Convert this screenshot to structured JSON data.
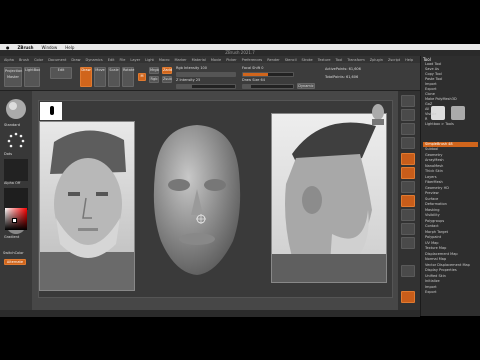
{
  "mac_menu": {
    "apple": "",
    "app": "ZBrush",
    "window": "Window",
    "help": "Help"
  },
  "window_title": "ZBrush 2021.7",
  "main_menu": [
    "Alpha",
    "Brush",
    "Color",
    "Document",
    "Draw",
    "Dynamics",
    "Edit",
    "File",
    "Layer",
    "Light",
    "Macro",
    "Marker",
    "Material",
    "Movie",
    "Picker",
    "Preferences",
    "Render",
    "Stencil",
    "Stroke",
    "Texture",
    "Tool",
    "Transform",
    "Zplugin",
    "Zscript",
    "Help"
  ],
  "top_shelf": {
    "projection": "Projection Master",
    "lightbox": "LightBox",
    "edit": "Edit",
    "draw": "Draw",
    "move": "Move",
    "scale": "Scale",
    "rotate": "Rotate",
    "mrgb": "Mrgb",
    "rgb": "Rgb",
    "m": "M",
    "zadd": "Zadd",
    "zsub": "Zsub",
    "zcut": "Zcut",
    "focal_shift": "Focal Shift 0",
    "draw_size": "Draw Size 64",
    "dynamic": "Dynamic",
    "z_intensity": "Z Intensity 25",
    "rgb_intensity": "Rgb Intensity 100",
    "active_points": "ActivePoints: 61,606",
    "total_points": "TotalPoints: 61,606"
  },
  "left_shelf": {
    "brush": "Standard",
    "stroke": "Dots",
    "alpha": "Alpha Off",
    "texture": "Texture Off",
    "material": "MatCap Gray",
    "gradient": "Gradient",
    "switch_color": "SwitchColor",
    "alternate": "Alternate"
  },
  "right_panel": {
    "header": "Tool",
    "items": [
      "Load Tool",
      "Save As",
      "Copy Tool",
      "Paste Tool",
      "Import",
      "Export",
      "Clone",
      "Make PolyMesh3D",
      "GoZ",
      "All",
      "Visible",
      "R",
      "Lightbox > Tools",
      "SimpleBrush 48",
      "Subtool",
      "Geometry",
      "ArrayMesh",
      "NanoMesh",
      "Thick Skin",
      "Layers",
      "FiberMesh",
      "Geometry HD",
      "Preview",
      "Surface",
      "Deformation",
      "Masking",
      "Visibility",
      "Polygroups",
      "Contact",
      "Morph Target",
      "Polypaint",
      "UV Map",
      "Texture Map",
      "Displacement Map",
      "Normal Map",
      "Vector Displacement Map",
      "Display Properties",
      "Unified Skin",
      "Initialize",
      "Import",
      "Export"
    ],
    "selected_index": 13
  },
  "colors": {
    "accent": "#d0651c",
    "panel": "#2e2e2e",
    "canvas": "#474747"
  },
  "icons": [
    "apple-icon",
    "lightbox-icon",
    "brush-icon",
    "stroke-icon",
    "alpha-icon",
    "texture-icon",
    "material-icon",
    "color-picker-icon",
    "head-sculpt-icon",
    "transform-gizmo-icon"
  ]
}
